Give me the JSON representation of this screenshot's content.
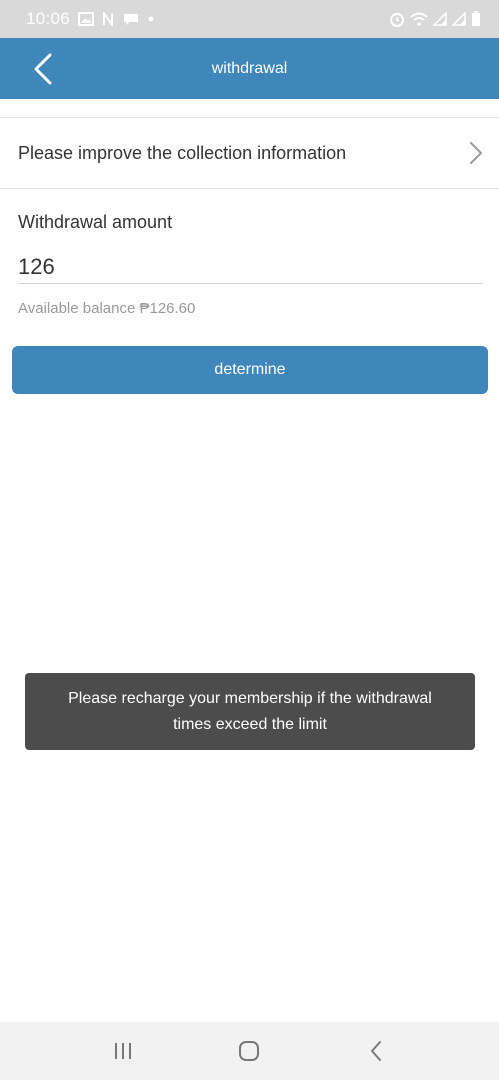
{
  "status_bar": {
    "time": "10:06",
    "left_icons": [
      "image-icon",
      "n-icon",
      "chat-bubble-icon",
      "dot-icon"
    ],
    "right_icons": [
      "alarm-icon",
      "wifi-icon",
      "signal-icon",
      "signal-icon",
      "battery-icon"
    ]
  },
  "header": {
    "title": "withdrawal",
    "back_icon": "chevron-left-icon"
  },
  "collection": {
    "label": "Please improve the collection information",
    "arrow_icon": "chevron-right-icon"
  },
  "withdrawal": {
    "amount_label": "Withdrawal amount",
    "amount_value": "126",
    "balance_text": "Available balance ₱126.60"
  },
  "actions": {
    "determine_label": "determine"
  },
  "toast": {
    "message": "Please recharge your membership if the withdrawal times exceed the limit"
  },
  "nav": {
    "recents_icon": "recents-icon",
    "home_icon": "home-icon",
    "back_icon": "back-icon"
  },
  "colors": {
    "primary": "#3f87bb",
    "toast_bg": "#4c4c4c",
    "status_bar_bg": "#d9d9d9",
    "muted_text": "#999999"
  }
}
